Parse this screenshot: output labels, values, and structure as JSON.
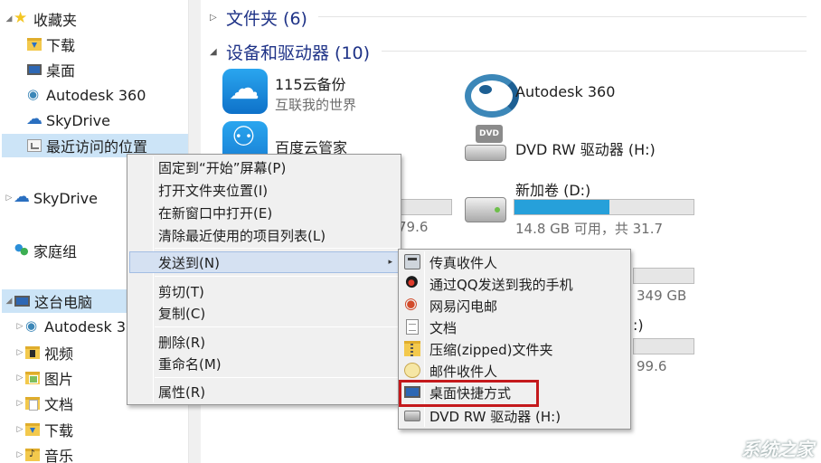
{
  "nav": {
    "favorites_label": "收藏夹",
    "favorites": [
      {
        "label": "下载",
        "icon": "downloads-folder-icon"
      },
      {
        "label": "桌面",
        "icon": "desktop-icon"
      },
      {
        "label": "Autodesk 360",
        "icon": "autodesk-360-icon"
      },
      {
        "label": "SkyDrive",
        "icon": "skydrive-icon"
      },
      {
        "label": "最近访问的位置",
        "icon": "recent-places-icon"
      }
    ],
    "skydrive_label": "SkyDrive",
    "homegroup_label": "家庭组",
    "this_pc_label": "这台电脑",
    "this_pc_children": [
      {
        "label": "Autodesk 3",
        "icon": "autodesk-360-icon"
      },
      {
        "label": "视频",
        "icon": "videos-folder-icon"
      },
      {
        "label": "图片",
        "icon": "pictures-folder-icon"
      },
      {
        "label": "文档",
        "icon": "documents-folder-icon"
      },
      {
        "label": "下载",
        "icon": "downloads-folder-icon"
      },
      {
        "label": "音乐",
        "icon": "music-folder-icon"
      }
    ]
  },
  "content": {
    "folders_group": "文件夹 (6)",
    "devices_group": "设备和驱动器 (10)",
    "tiles": {
      "app115_name": "115云备份",
      "app115_sub": "互联我的世界",
      "a360_name": "Autodesk 360",
      "baidu_name": "百度云管家",
      "dvd_name": "DVD RW 驱动器 (H:)",
      "disk_d_name": "新加卷 (D:)",
      "disk_d_sub": "14.8 GB 可用，共 31.7",
      "disk_d_used_fraction": 0.53,
      "partial_left_sub": "79.6",
      "partial_right_sub": "349 GB",
      "partial_right2_sub": "99.6",
      "partial_colon": ":)"
    }
  },
  "context_menu": {
    "items": [
      {
        "label": "固定到“开始”屏幕(P)"
      },
      {
        "label": "打开文件夹位置(I)"
      },
      {
        "label": "在新窗口中打开(E)"
      },
      {
        "label": "清除最近使用的项目列表(L)"
      },
      {
        "label": "发送到(N)"
      },
      {
        "label": "剪切(T)"
      },
      {
        "label": "复制(C)"
      },
      {
        "label": "删除(R)"
      },
      {
        "label": "重命名(M)"
      },
      {
        "label": "属性(R)"
      }
    ],
    "submenu_arrow": "▸"
  },
  "send_to_menu": {
    "items": [
      {
        "label": "传真收件人",
        "icon": "fax-icon"
      },
      {
        "label": "通过QQ发送到我的手机",
        "icon": "qq-icon"
      },
      {
        "label": "网易闪电邮",
        "icon": "netease-mail-icon"
      },
      {
        "label": "文档",
        "icon": "document-icon"
      },
      {
        "label": "压缩(zipped)文件夹",
        "icon": "zip-folder-icon"
      },
      {
        "label": "邮件收件人",
        "icon": "mail-recipient-icon"
      },
      {
        "label": "桌面快捷方式",
        "icon": "desktop-shortcut-icon"
      },
      {
        "label": "DVD RW 驱动器 (H:)",
        "icon": "dvd-drive-icon"
      }
    ]
  },
  "watermark": "系统之家",
  "colors": {
    "selection": "#cce4f7",
    "accent": "#26a0da",
    "highlight_box": "#c4191c",
    "group_header": "#1e3287"
  }
}
